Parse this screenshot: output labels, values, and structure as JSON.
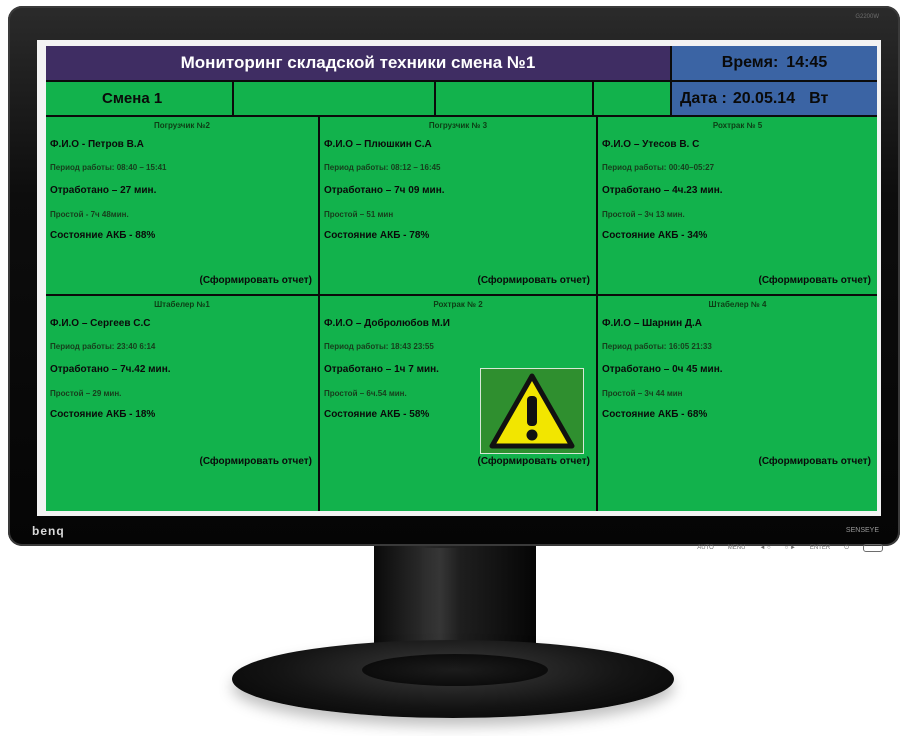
{
  "monitor": {
    "brand": "benq",
    "model_mark": "SENSEYE",
    "corner_mark": "G2200W",
    "buttons": [
      "AUTO",
      "MENU",
      "◄ ○",
      "○ ►",
      "ENTER",
      "⏻"
    ]
  },
  "header": {
    "title": "Мониторинг складской техники смена №1",
    "time_label": "Время:",
    "time_value": "14:45",
    "date_label": "Дата :",
    "date_value": "20.05.14",
    "weekday": "Вт"
  },
  "shift": {
    "label": "Смена 1"
  },
  "panels": [
    {
      "title": "Погрузчик №2",
      "fio": "Ф.И.О - Петров В.А",
      "period": "Период работы: 08:40 – 15:41",
      "worked": "Отработано – 27 мин.",
      "idle": "Простой - 7ч 48мин.",
      "akb": "Состояние АКБ - 88%",
      "report": "(Сформировать отчет)"
    },
    {
      "title": "Погрузчик № 3",
      "fio": "Ф.И.О – Плюшкин С.А",
      "period": "Период работы: 08:12 – 16:45",
      "worked": "Отработано – 7ч 09 мин.",
      "idle": "Простой – 51 мин",
      "akb": "Состояние АКБ - 78%",
      "report": "(Сформировать отчет)"
    },
    {
      "title": "Рохтрак № 5",
      "fio": "Ф.И.О – Утесов В. С",
      "period": "Период работы: 00:40–05:27",
      "worked": "Отработано – 4ч.23 мин.",
      "idle": "Простой – 3ч 13 мин.",
      "akb": "Состояние АКБ - 34%",
      "report": "(Сформировать отчет)"
    },
    {
      "title": "Штабелер №1",
      "fio": "Ф.И.О – Сергеев С.С",
      "period": "Период работы: 23:40 6:14",
      "worked": "Отработано – 7ч.42 мин.",
      "idle": "Простой – 29 мин.",
      "akb": "Состояние АКБ - 18%",
      "report": "(Сформировать отчет)"
    },
    {
      "title": "Рохтрак № 2",
      "fio": "Ф.И.О – Добролюбов М.И",
      "period": "Период работы: 18:43 23:55",
      "worked": "Отработано – 1ч 7 мин.",
      "idle": "Простой – 6ч.54 мин.",
      "akb": "Состояние АКБ - 58%",
      "report": "(Сформировать отчет)",
      "warning_icon": "warning-triangle-icon"
    },
    {
      "title": "Штабелер № 4",
      "fio": "Ф.И.О – Шарнин Д.А",
      "period": "Период работы: 16:05 21:33",
      "worked": "Отработано – 0ч 45 мин.",
      "idle": "Простой – 3ч 44 мин",
      "akb": "Состояние АКБ - 68%",
      "report": "(Сформировать отчет)"
    }
  ],
  "colors": {
    "title_bar": "#3f2d63",
    "time_bar": "#3b64a4",
    "panel_green": "#12b24c",
    "warning_yellow": "#f2e600"
  }
}
